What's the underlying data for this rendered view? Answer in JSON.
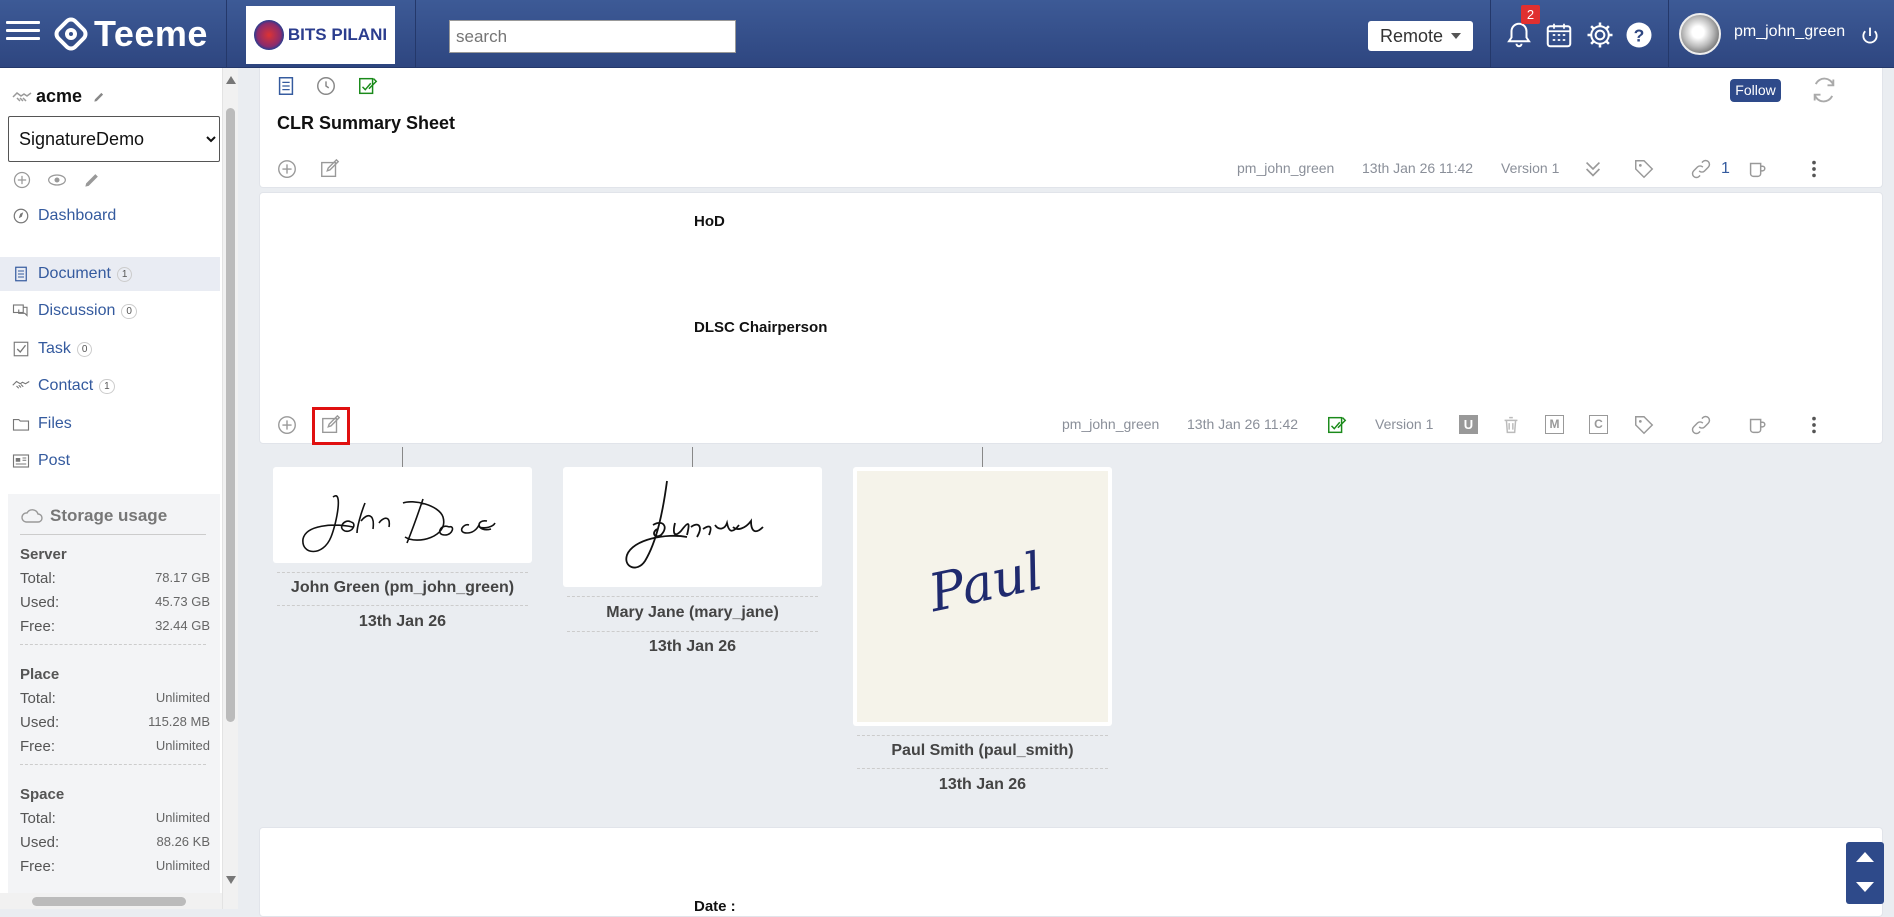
{
  "app": {
    "name": "Teeme",
    "org_logo_text": "BITS PILANI"
  },
  "header": {
    "search_placeholder": "search",
    "mode_select": "Remote",
    "notification_count": "2",
    "username": "pm_john_green"
  },
  "sidebar": {
    "space_name": "acme",
    "place_select": "SignatureDemo",
    "dashboard": "Dashboard",
    "items": [
      {
        "label": "Document",
        "count": "1"
      },
      {
        "label": "Discussion",
        "count": "0"
      },
      {
        "label": "Task",
        "count": "0"
      },
      {
        "label": "Contact",
        "count": "1"
      },
      {
        "label": "Files",
        "count": ""
      },
      {
        "label": "Post",
        "count": ""
      }
    ],
    "storage": {
      "title": "Storage usage",
      "sections": [
        {
          "name": "Server",
          "rows": [
            {
              "k": "Total:",
              "v": "78.17 GB"
            },
            {
              "k": "Used:",
              "v": "45.73 GB"
            },
            {
              "k": "Free:",
              "v": "32.44 GB"
            }
          ]
        },
        {
          "name": "Place",
          "rows": [
            {
              "k": "Total:",
              "v": "Unlimited"
            },
            {
              "k": "Used:",
              "v": "115.28 MB"
            },
            {
              "k": "Free:",
              "v": "Unlimited"
            }
          ]
        },
        {
          "name": "Space",
          "rows": [
            {
              "k": "Total:",
              "v": "Unlimited"
            },
            {
              "k": "Used:",
              "v": "88.26 KB"
            },
            {
              "k": "Free:",
              "v": "Unlimited"
            }
          ]
        }
      ]
    }
  },
  "document": {
    "title": "CLR Summary Sheet",
    "follow_label": "Follow",
    "meta": {
      "author": "pm_john_green",
      "date": "13th Jan 26 11:42",
      "version": "Version 1",
      "link_count": "1"
    }
  },
  "section": {
    "hod": "HoD",
    "dlsc": "DLSC Chairperson",
    "meta": {
      "author": "pm_john_green",
      "date": "13th Jan 26 11:42",
      "version": "Version 1"
    },
    "badges": [
      "U",
      "M",
      "C"
    ]
  },
  "signatures": [
    {
      "name": "John Green (pm_john_green)",
      "date": "13th Jan 26",
      "sig_text": "John Doe"
    },
    {
      "name": "Mary Jane (mary_jane)",
      "date": "13th Jan 26",
      "sig_text": ""
    },
    {
      "name": "Paul Smith (paul_smith)",
      "date": "13th Jan 26",
      "sig_text": "Paul"
    }
  ],
  "next_card": {
    "label": "Date :"
  },
  "colors": {
    "header": "#2e4680",
    "accent": "#2e4a8a",
    "highlight": "#e01010",
    "approved": "#1a8a1a"
  }
}
